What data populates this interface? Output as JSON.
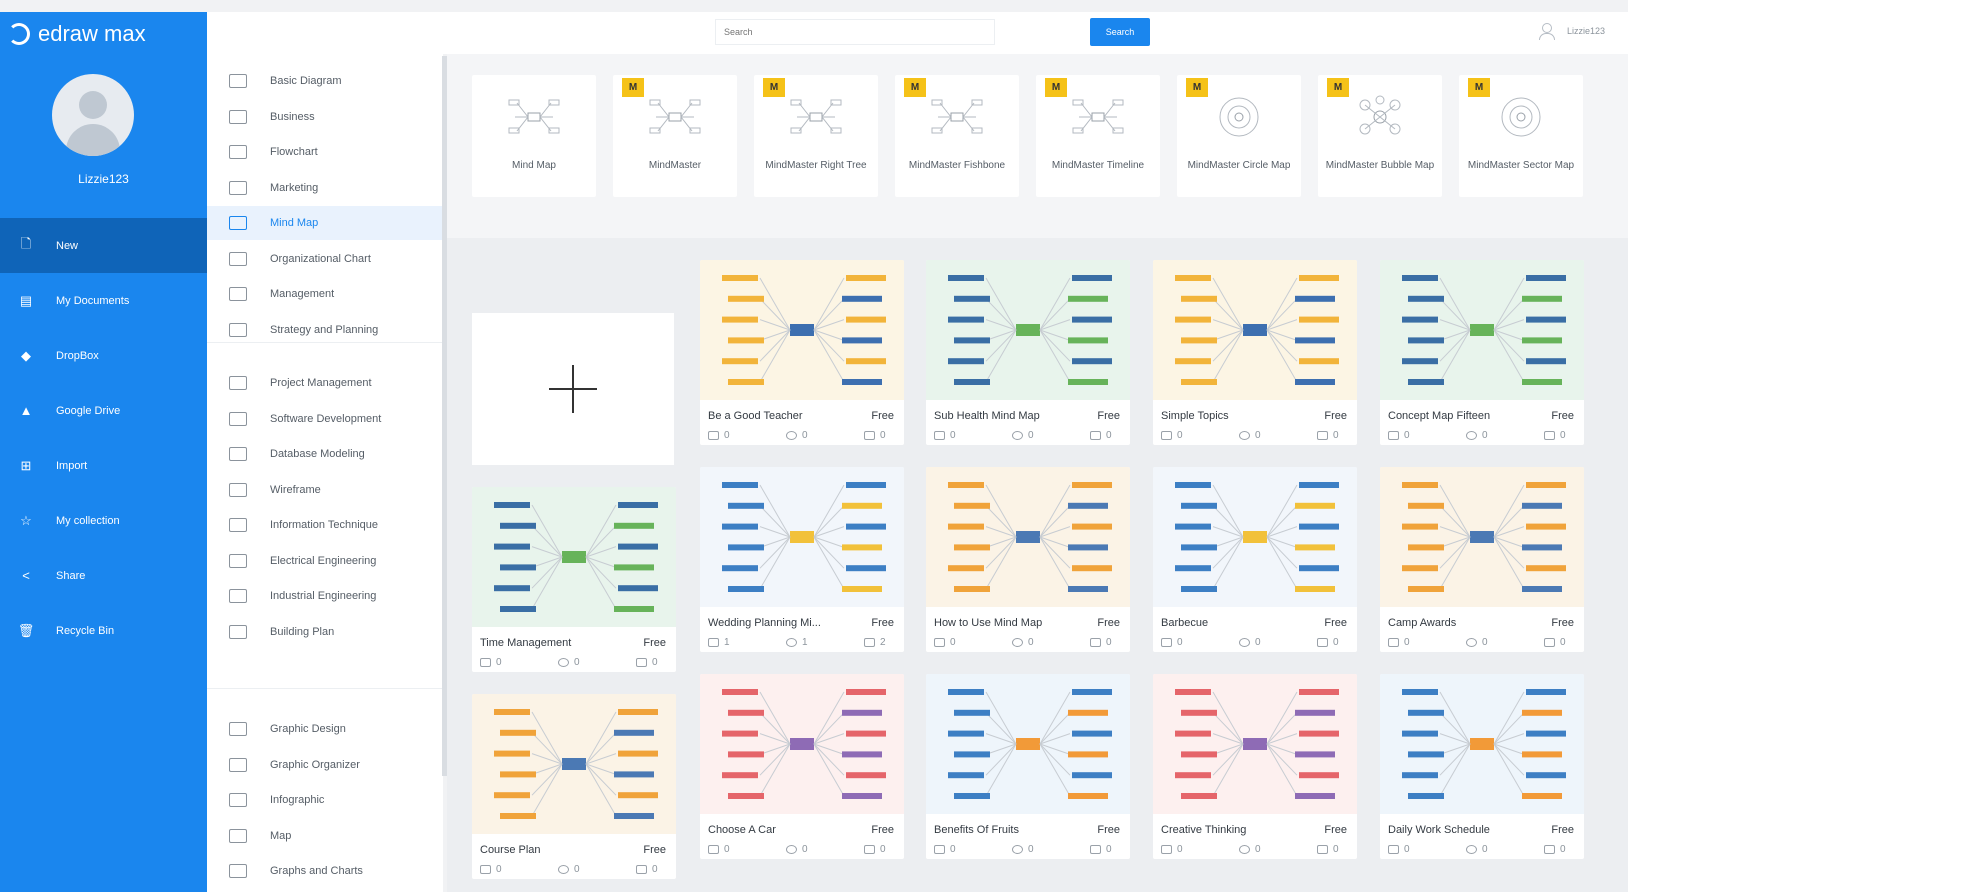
{
  "app": {
    "logo_text": "edraw max"
  },
  "user": {
    "name": "Lizzie123"
  },
  "nav": {
    "items": [
      {
        "label": "New",
        "icon": "new-file-icon",
        "glyph": "🗋"
      },
      {
        "label": "My Documents",
        "icon": "documents-icon",
        "glyph": "▤"
      },
      {
        "label": "DropBox",
        "icon": "dropbox-icon",
        "glyph": "◆"
      },
      {
        "label": "Google Drive",
        "icon": "google-drive-icon",
        "glyph": "▲"
      },
      {
        "label": "Import",
        "icon": "import-icon",
        "glyph": "⊞"
      },
      {
        "label": "My collection",
        "icon": "star-icon",
        "glyph": "☆"
      },
      {
        "label": "Share",
        "icon": "share-icon",
        "glyph": "<"
      },
      {
        "label": "Recycle Bin",
        "icon": "trash-icon",
        "glyph": "🗑"
      }
    ]
  },
  "search": {
    "placeholder": "Search",
    "button_label": "Search"
  },
  "topbar": {
    "user_name": "Lizzie123"
  },
  "categories": {
    "group1": [
      "Basic Diagram",
      "Business",
      "Flowchart",
      "Marketing",
      "Mind Map",
      "Organizational Chart",
      "Management",
      "Strategy and Planning"
    ],
    "group2": [
      "Project Management",
      "Software Development",
      "Database Modeling",
      "Wireframe",
      "Information Technique",
      "Electrical Engineering",
      "Industrial Engineering",
      "Building Plan"
    ],
    "group3": [
      "Graphic Design",
      "Graphic Organizer",
      "Infographic",
      "Map",
      "Graphs and Charts"
    ],
    "active": "Mind Map"
  },
  "template_types": [
    {
      "label": "Mind Map",
      "badge": ""
    },
    {
      "label": "MindMaster",
      "badge": "M"
    },
    {
      "label": "MindMaster Right Tree",
      "badge": "M"
    },
    {
      "label": "MindMaster Fishbone",
      "badge": "M"
    },
    {
      "label": "MindMaster Timeline",
      "badge": "M"
    },
    {
      "label": "MindMaster Circle Map",
      "badge": "M"
    },
    {
      "label": "MindMaster Bubble Map",
      "badge": "M"
    },
    {
      "label": "MindMaster Sector Map",
      "badge": "M"
    }
  ],
  "gallery": {
    "columns": [
      [
        {
          "title": "Time Management",
          "price": "Free",
          "likes": "0",
          "favs": "0",
          "copies": "0"
        },
        {
          "title": "Course Plan",
          "price": "Free",
          "likes": "0",
          "favs": "0",
          "copies": "0"
        }
      ],
      [
        {
          "title": "Be a Good Teacher",
          "price": "Free",
          "likes": "0",
          "favs": "0",
          "copies": "0"
        },
        {
          "title": "Wedding Planning Mi...",
          "price": "Free",
          "likes": "1",
          "favs": "1",
          "copies": "2"
        },
        {
          "title": "Choose A Car",
          "price": "Free",
          "likes": "0",
          "favs": "0",
          "copies": "0"
        }
      ],
      [
        {
          "title": "Sub Health Mind Map",
          "price": "Free",
          "likes": "0",
          "favs": "0",
          "copies": "0"
        },
        {
          "title": "How to Use Mind Map",
          "price": "Free",
          "likes": "0",
          "favs": "0",
          "copies": "0"
        },
        {
          "title": "Benefits Of Fruits",
          "price": "Free",
          "likes": "0",
          "favs": "0",
          "copies": "0"
        }
      ],
      [
        {
          "title": "Simple Topics",
          "price": "Free",
          "likes": "0",
          "favs": "0",
          "copies": "0"
        },
        {
          "title": "Barbecue",
          "price": "Free",
          "likes": "0",
          "favs": "0",
          "copies": "0"
        },
        {
          "title": "Creative Thinking",
          "price": "Free",
          "likes": "0",
          "favs": "0",
          "copies": "0"
        }
      ],
      [
        {
          "title": "Concept Map Fifteen",
          "price": "Free",
          "likes": "0",
          "favs": "0",
          "copies": "0"
        },
        {
          "title": "Camp Awards",
          "price": "Free",
          "likes": "0",
          "favs": "0",
          "copies": "0"
        },
        {
          "title": "Daily Work Schedule",
          "price": "Free",
          "likes": "0",
          "favs": "0",
          "copies": "0"
        }
      ]
    ]
  },
  "colors": {
    "brand": "#1a86ee",
    "nav_active": "#0f64b8",
    "badge": "#f5c218"
  }
}
